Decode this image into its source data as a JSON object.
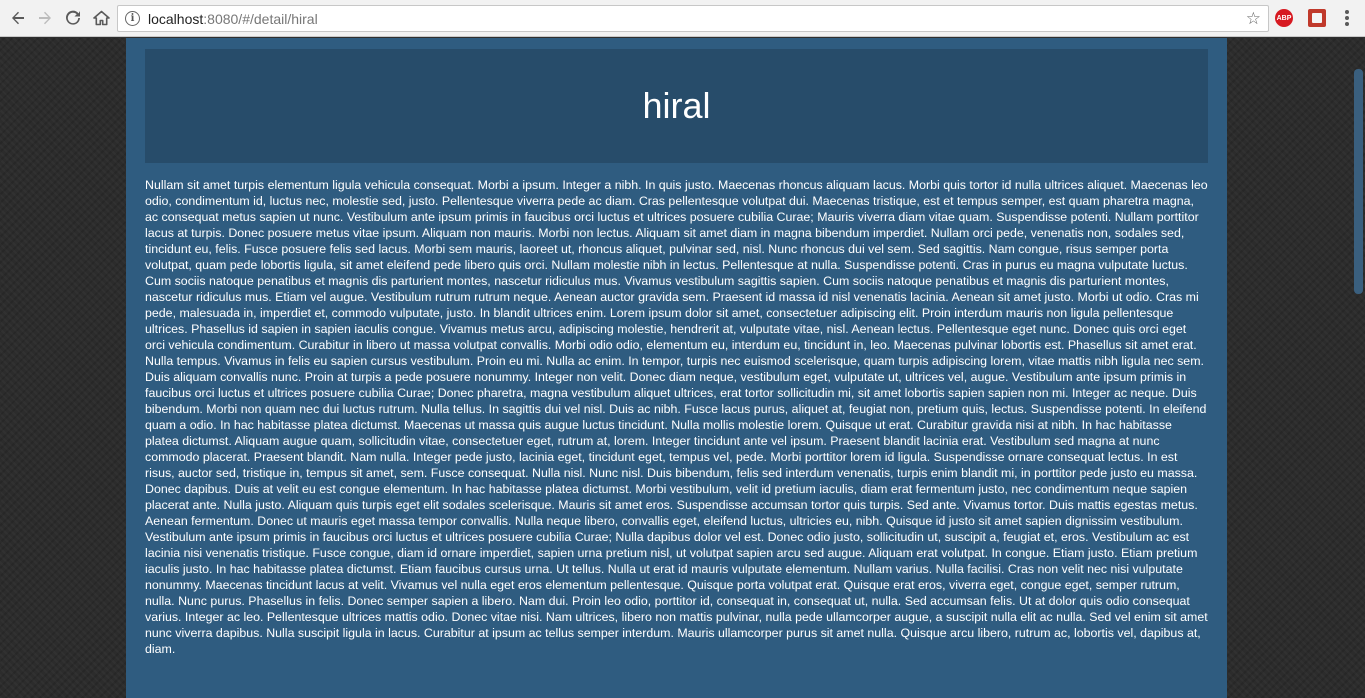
{
  "browser": {
    "url_host": "localhost",
    "url_rest": ":8080/#/detail/hiral",
    "extensions": {
      "abp_label": "ABP"
    }
  },
  "detail": {
    "title": "hiral",
    "body": "Nullam sit amet turpis elementum ligula vehicula consequat. Morbi a ipsum. Integer a nibh. In quis justo. Maecenas rhoncus aliquam lacus. Morbi quis tortor id nulla ultrices aliquet. Maecenas leo odio, condimentum id, luctus nec, molestie sed, justo. Pellentesque viverra pede ac diam. Cras pellentesque volutpat dui. Maecenas tristique, est et tempus semper, est quam pharetra magna, ac consequat metus sapien ut nunc. Vestibulum ante ipsum primis in faucibus orci luctus et ultrices posuere cubilia Curae; Mauris viverra diam vitae quam. Suspendisse potenti. Nullam porttitor lacus at turpis. Donec posuere metus vitae ipsum. Aliquam non mauris. Morbi non lectus. Aliquam sit amet diam in magna bibendum imperdiet. Nullam orci pede, venenatis non, sodales sed, tincidunt eu, felis. Fusce posuere felis sed lacus. Morbi sem mauris, laoreet ut, rhoncus aliquet, pulvinar sed, nisl. Nunc rhoncus dui vel sem. Sed sagittis. Nam congue, risus semper porta volutpat, quam pede lobortis ligula, sit amet eleifend pede libero quis orci. Nullam molestie nibh in lectus. Pellentesque at nulla. Suspendisse potenti. Cras in purus eu magna vulputate luctus. Cum sociis natoque penatibus et magnis dis parturient montes, nascetur ridiculus mus. Vivamus vestibulum sagittis sapien. Cum sociis natoque penatibus et magnis dis parturient montes, nascetur ridiculus mus. Etiam vel augue. Vestibulum rutrum rutrum neque. Aenean auctor gravida sem. Praesent id massa id nisl venenatis lacinia. Aenean sit amet justo. Morbi ut odio. Cras mi pede, malesuada in, imperdiet et, commodo vulputate, justo. In blandit ultrices enim. Lorem ipsum dolor sit amet, consectetuer adipiscing elit. Proin interdum mauris non ligula pellentesque ultrices. Phasellus id sapien in sapien iaculis congue. Vivamus metus arcu, adipiscing molestie, hendrerit at, vulputate vitae, nisl. Aenean lectus. Pellentesque eget nunc. Donec quis orci eget orci vehicula condimentum. Curabitur in libero ut massa volutpat convallis. Morbi odio odio, elementum eu, interdum eu, tincidunt in, leo. Maecenas pulvinar lobortis est. Phasellus sit amet erat. Nulla tempus. Vivamus in felis eu sapien cursus vestibulum. Proin eu mi. Nulla ac enim. In tempor, turpis nec euismod scelerisque, quam turpis adipiscing lorem, vitae mattis nibh ligula nec sem. Duis aliquam convallis nunc. Proin at turpis a pede posuere nonummy. Integer non velit. Donec diam neque, vestibulum eget, vulputate ut, ultrices vel, augue. Vestibulum ante ipsum primis in faucibus orci luctus et ultrices posuere cubilia Curae; Donec pharetra, magna vestibulum aliquet ultrices, erat tortor sollicitudin mi, sit amet lobortis sapien sapien non mi. Integer ac neque. Duis bibendum. Morbi non quam nec dui luctus rutrum. Nulla tellus. In sagittis dui vel nisl. Duis ac nibh. Fusce lacus purus, aliquet at, feugiat non, pretium quis, lectus. Suspendisse potenti. In eleifend quam a odio. In hac habitasse platea dictumst. Maecenas ut massa quis augue luctus tincidunt. Nulla mollis molestie lorem. Quisque ut erat. Curabitur gravida nisi at nibh. In hac habitasse platea dictumst. Aliquam augue quam, sollicitudin vitae, consectetuer eget, rutrum at, lorem. Integer tincidunt ante vel ipsum. Praesent blandit lacinia erat. Vestibulum sed magna at nunc commodo placerat. Praesent blandit. Nam nulla. Integer pede justo, lacinia eget, tincidunt eget, tempus vel, pede. Morbi porttitor lorem id ligula. Suspendisse ornare consequat lectus. In est risus, auctor sed, tristique in, tempus sit amet, sem. Fusce consequat. Nulla nisl. Nunc nisl. Duis bibendum, felis sed interdum venenatis, turpis enim blandit mi, in porttitor pede justo eu massa. Donec dapibus. Duis at velit eu est congue elementum. In hac habitasse platea dictumst. Morbi vestibulum, velit id pretium iaculis, diam erat fermentum justo, nec condimentum neque sapien placerat ante. Nulla justo. Aliquam quis turpis eget elit sodales scelerisque. Mauris sit amet eros. Suspendisse accumsan tortor quis turpis. Sed ante. Vivamus tortor. Duis mattis egestas metus. Aenean fermentum. Donec ut mauris eget massa tempor convallis. Nulla neque libero, convallis eget, eleifend luctus, ultricies eu, nibh. Quisque id justo sit amet sapien dignissim vestibulum. Vestibulum ante ipsum primis in faucibus orci luctus et ultrices posuere cubilia Curae; Nulla dapibus dolor vel est. Donec odio justo, sollicitudin ut, suscipit a, feugiat et, eros. Vestibulum ac est lacinia nisi venenatis tristique. Fusce congue, diam id ornare imperdiet, sapien urna pretium nisl, ut volutpat sapien arcu sed augue. Aliquam erat volutpat. In congue. Etiam justo. Etiam pretium iaculis justo. In hac habitasse platea dictumst. Etiam faucibus cursus urna. Ut tellus. Nulla ut erat id mauris vulputate elementum. Nullam varius. Nulla facilisi. Cras non velit nec nisi vulputate nonummy. Maecenas tincidunt lacus at velit. Vivamus vel nulla eget eros elementum pellentesque. Quisque porta volutpat erat. Quisque erat eros, viverra eget, congue eget, semper rutrum, nulla. Nunc purus. Phasellus in felis. Donec semper sapien a libero. Nam dui. Proin leo odio, porttitor id, consequat in, consequat ut, nulla. Sed accumsan felis. Ut at dolor quis odio consequat varius. Integer ac leo. Pellentesque ultrices mattis odio. Donec vitae nisi. Nam ultrices, libero non mattis pulvinar, nulla pede ullamcorper augue, a suscipit nulla elit ac nulla. Sed vel enim sit amet nunc viverra dapibus. Nulla suscipit ligula in lacus. Curabitur at ipsum ac tellus semper interdum. Mauris ullamcorper purus sit amet nulla. Quisque arcu libero, rutrum ac, lobortis vel, dapibus at, diam."
  },
  "colors": {
    "page_background": "#2f5c80",
    "header_background": "#274c6a",
    "text": "#ffffff"
  },
  "icons": [
    "back-arrow-icon",
    "forward-arrow-icon",
    "reload-icon",
    "home-icon",
    "info-icon",
    "star-icon",
    "adblock-plus-icon",
    "extension-icon",
    "menu-icon"
  ]
}
